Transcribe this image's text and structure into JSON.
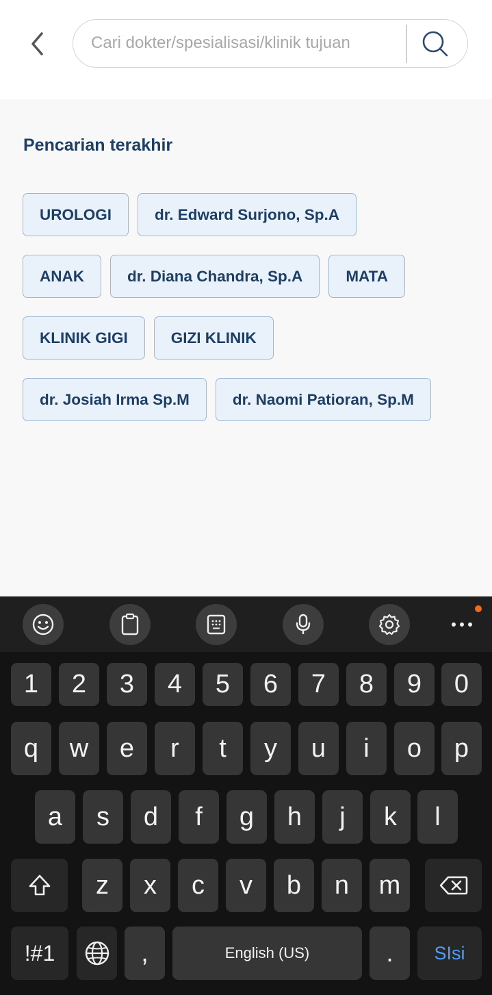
{
  "header": {
    "back_icon": "chevron-left-icon",
    "search": {
      "placeholder": "Cari dokter/spesialisasi/klinik tujuan",
      "value": "",
      "icon": "search-icon"
    }
  },
  "recent": {
    "title": "Pencarian terakhir",
    "rows": [
      [
        "UROLOGI",
        "dr. Edward Surjono, Sp.A"
      ],
      [
        "ANAK",
        "dr. Diana Chandra, Sp.A",
        "MATA"
      ],
      [
        "KLINIK GIGI",
        "GIZI KLINIK"
      ],
      [
        "dr. Josiah Irma Sp.M",
        "dr. Naomi Patioran, Sp.M"
      ]
    ]
  },
  "keyboard": {
    "toolbar": [
      "emoji-icon",
      "clipboard-icon",
      "keypad-icon",
      "microphone-icon",
      "settings-icon",
      "more-icon"
    ],
    "numbers": [
      "1",
      "2",
      "3",
      "4",
      "5",
      "6",
      "7",
      "8",
      "9",
      "0"
    ],
    "row1": [
      "q",
      "w",
      "e",
      "r",
      "t",
      "y",
      "u",
      "i",
      "o",
      "p"
    ],
    "row2": [
      "a",
      "s",
      "d",
      "f",
      "g",
      "h",
      "j",
      "k",
      "l"
    ],
    "row3": [
      "z",
      "x",
      "c",
      "v",
      "b",
      "n",
      "m"
    ],
    "symbols_label": "!#1",
    "comma": ",",
    "space_label": "English (US)",
    "period": ".",
    "enter_label": "SIsi",
    "accent_color": "#4d9dff",
    "notification_color": "#f26b1d"
  }
}
